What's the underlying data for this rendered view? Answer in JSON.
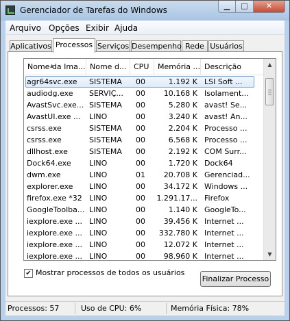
{
  "window": {
    "title": "Gerenciador de Tarefas do Windows"
  },
  "caption_buttons": {
    "minimize": "▁",
    "maximize": "□",
    "close": "✕"
  },
  "menu": [
    "Arquivo",
    "Opções",
    "Exibir",
    "Ajuda"
  ],
  "tabs": [
    "Aplicativos",
    "Processos",
    "Serviços",
    "Desempenho",
    "Rede",
    "Usuários"
  ],
  "active_tab": "Processos",
  "columns": [
    "Nome da Ima...",
    "Nome d...",
    "CPU",
    "Memória ...",
    "Descrição"
  ],
  "sort": {
    "column": "Nome da Ima...",
    "direction": "ascending"
  },
  "rows": [
    {
      "image": "agr64svc.exe",
      "user": "SISTEMA",
      "cpu": "00",
      "memory": "1.192 K",
      "description": "LSI Soft ...",
      "selected": true
    },
    {
      "image": "audiodg.exe",
      "user": "SERVIÇ...",
      "cpu": "00",
      "memory": "10.168 K",
      "description": "Isolament..."
    },
    {
      "image": "AvastSvc.exe...",
      "user": "SISTEMA",
      "cpu": "00",
      "memory": "5.280 K",
      "description": "avast! Se..."
    },
    {
      "image": "AvastUI.exe ...",
      "user": "LINO",
      "cpu": "00",
      "memory": "3.240 K",
      "description": "avast! An..."
    },
    {
      "image": "csrss.exe",
      "user": "SISTEMA",
      "cpu": "00",
      "memory": "2.204 K",
      "description": "Processo ..."
    },
    {
      "image": "csrss.exe",
      "user": "SISTEMA",
      "cpu": "00",
      "memory": "6.568 K",
      "description": "Processo ..."
    },
    {
      "image": "dllhost.exe",
      "user": "SISTEMA",
      "cpu": "00",
      "memory": "2.192 K",
      "description": "COM Surr..."
    },
    {
      "image": "Dock64.exe",
      "user": "LINO",
      "cpu": "00",
      "memory": "1.720 K",
      "description": "Dock64"
    },
    {
      "image": "dwm.exe",
      "user": "LINO",
      "cpu": "01",
      "memory": "20.708 K",
      "description": "Gerenciad..."
    },
    {
      "image": "explorer.exe",
      "user": "LINO",
      "cpu": "00",
      "memory": "34.172 K",
      "description": "Windows ..."
    },
    {
      "image": "firefox.exe *32",
      "user": "LINO",
      "cpu": "00",
      "memory": "1.291.17...",
      "description": "Firefox"
    },
    {
      "image": "GoogleToolba...",
      "user": "LINO",
      "cpu": "00",
      "memory": "1.140 K",
      "description": "GoogleTo..."
    },
    {
      "image": "iexplore.exe ...",
      "user": "LINO",
      "cpu": "00",
      "memory": "39.456 K",
      "description": "Internet ..."
    },
    {
      "image": "iexplore.exe ...",
      "user": "LINO",
      "cpu": "00",
      "memory": "332.780 K",
      "description": "Internet ..."
    },
    {
      "image": "iexplore.exe ...",
      "user": "LINO",
      "cpu": "00",
      "memory": "12.072 K",
      "description": "Internet ..."
    },
    {
      "image": "iexplore.exe ...",
      "user": "LINO",
      "cpu": "00",
      "memory": "98.960 K",
      "description": "Internet ..."
    }
  ],
  "show_all_users": {
    "label": "Mostrar processos de todos os usuários",
    "checked": true
  },
  "end_process_button": "Finalizar Processo",
  "status": {
    "processes": "Processos: 57",
    "cpu_usage": "Uso de CPU: 6%",
    "physical_memory": "Memória Física: 78%"
  },
  "colors": {
    "frame": "#b9d1ea",
    "close_button": "#c44a34",
    "selection": "#dcebfc"
  }
}
